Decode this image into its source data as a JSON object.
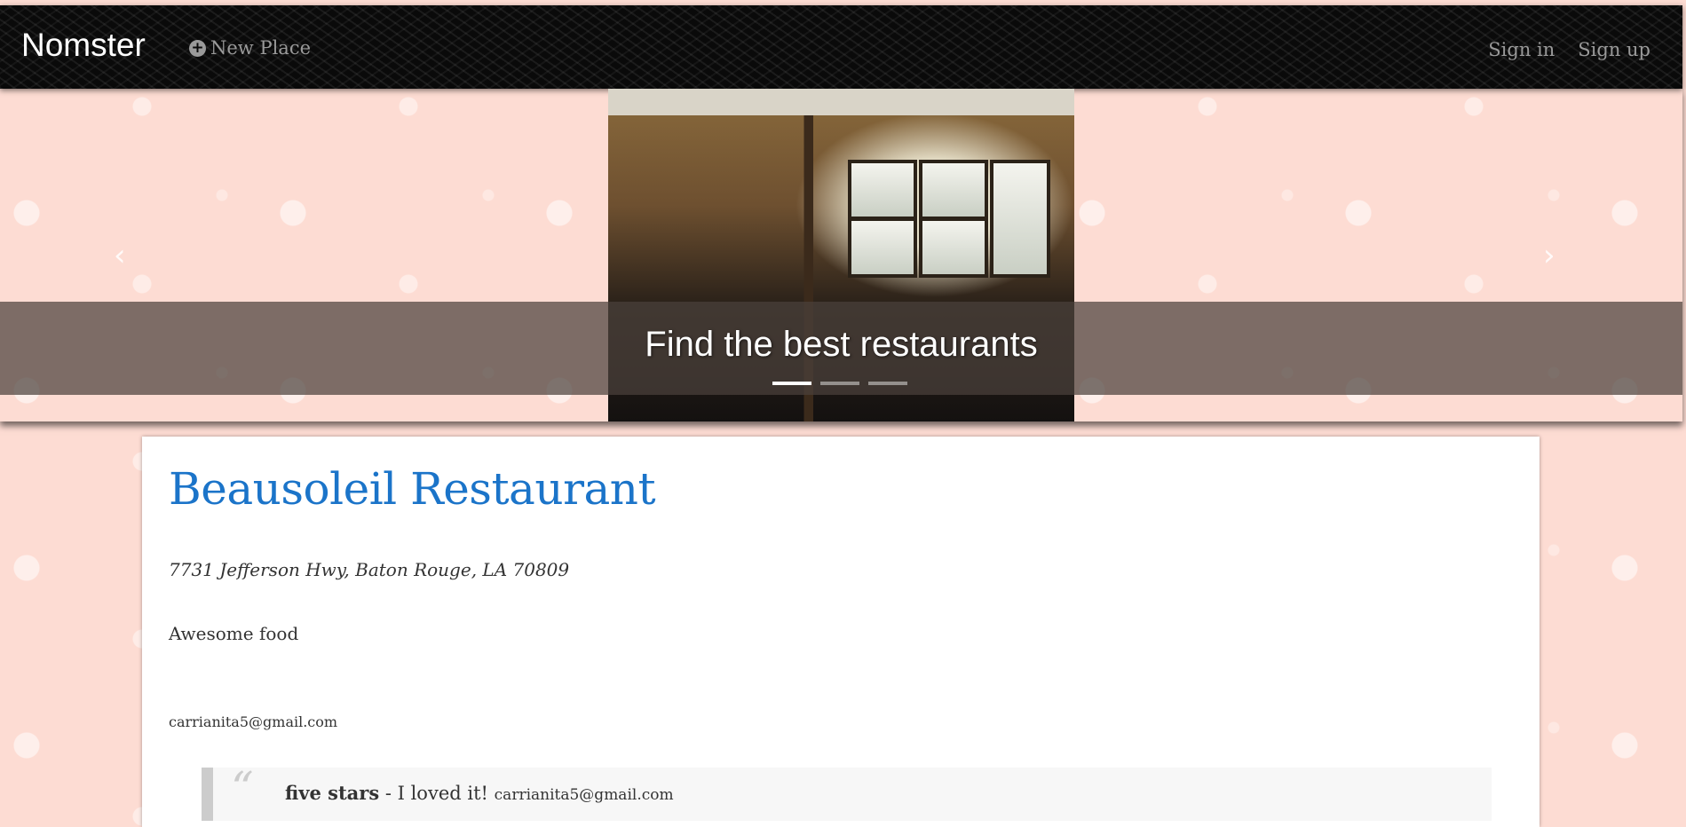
{
  "navbar": {
    "brand": "Nomster",
    "new_place_label": "New Place",
    "sign_in_label": "Sign in",
    "sign_up_label": "Sign up"
  },
  "carousel": {
    "caption": "Find the best restaurants",
    "slide_count": 3,
    "active_slide": 1
  },
  "place": {
    "name": "Beausoleil Restaurant",
    "address": "7731 Jefferson Hwy, Baton Rouge, LA 70809",
    "description": "Awesome food",
    "owner_email": "carrianita5@gmail.com"
  },
  "comments": [
    {
      "rating": "five stars",
      "separator": " - ",
      "message": "I loved it!",
      "email": "carrianita5@gmail.com"
    }
  ],
  "icons": {
    "new_place": "plus-circle-icon",
    "quote": "quote-icon"
  },
  "colors": {
    "navbar_bg": "#0a0a0a",
    "page_bg": "#fddcd3",
    "title": "#1b74c9",
    "nav_text": "#9a9a9a"
  }
}
